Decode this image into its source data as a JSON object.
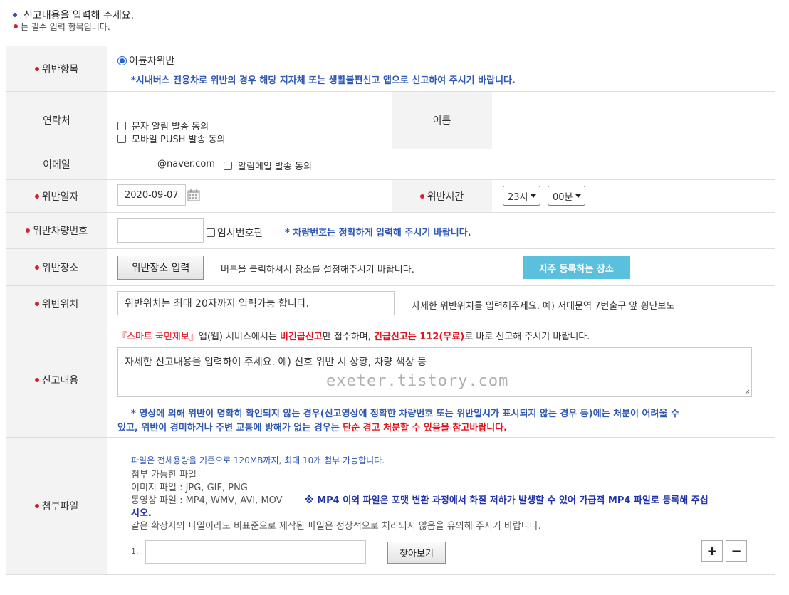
{
  "intro": {
    "line1": "신고내용을 입력해 주세요.",
    "line2": "는 필수 입력 항목입니다."
  },
  "violation_type": {
    "label": "위반항목",
    "radio_label": "이륜차위반",
    "notice": "*시내버스 전용차로 위반의 경우 해당 지자체 또는 생활불편신고 앱으로 신고하여 주시기 바랍니다."
  },
  "contact": {
    "label": "연락처",
    "sms_consent": "문자 알림 발송 동의",
    "push_consent": "모바일 PUSH 발송 동의",
    "name_label": "이름"
  },
  "email": {
    "label": "이메일",
    "domain": "@naver.com",
    "mail_consent": "알림메일 발송 동의"
  },
  "violation_date": {
    "label": "위반일자",
    "value": "2020-09-07",
    "time_label": "위반시간",
    "hour": "23시",
    "minute": "00분"
  },
  "plate": {
    "label": "위반차량번호",
    "temp_plate": "임시번호판",
    "notice": "* 차량번호는 정확하게 입력해 주시기 바랍니다."
  },
  "place": {
    "label": "위반장소",
    "input_button": "위반장소 입력",
    "help": "버튼을 클릭하셔서 장소를 설정해주시기 바랍니다.",
    "favorites_button": "자주 등록하는 장소"
  },
  "location": {
    "label": "위반위치",
    "placeholder": "위반위치는 최대 20자까지 입력가능 합니다.",
    "help": "자세한 위반위치를 입력해주세요. 예) 서대문역 7번출구 앞 횡단보도"
  },
  "content": {
    "label": "신고내용",
    "notice_part1": "『스마트 국민제보』",
    "notice_part2": "앱(웹) 서비스에서는 ",
    "notice_part3": "비긴급신고",
    "notice_part4": "만 접수하며, ",
    "notice_part5": "긴급신고는 112(무료)",
    "notice_part6": "로 바로 신고해 주시기 바랍니다.",
    "textarea_placeholder": "자세한 신고내용을 입력하여 주세요. 예) 신호 위반 시 상황, 차량 색상 등",
    "watermark": "exeter.tistory.com",
    "warning_line1": "* 영상에 의해 위반이 명확히 확인되지 않는 경우(신고영상에 정확한 차량번호 또는 위반일시가 표시되지 않는 경우 등)에는 처분이 어려울 수",
    "warning_line2a": "있고, 위반이 경미하거나 주변 교통에 방해가 없는 경우는 ",
    "warning_line2b": "단순 경고 처분할 수 있음을 참고바랍니다."
  },
  "attachment": {
    "label": "첨부파일",
    "size_limit": "파일은 전체용량을 기준으로 120MB까지, 최대 10개 첨부 가능합니다.",
    "allowed_title": "첨부 가능한 파일",
    "image_types": "이미지 파일 : JPG, GIF, PNG",
    "video_types": "동영상 파일 : MP4, WMV, AVI, MOV",
    "mp4_notice_line1": "※ MP4 이외 파일은 포맷 변환 과정에서 화질 저하가 발생할 수 있어 가급적 MP4 파일로 등록해 주십",
    "mp4_notice_line2": "시오.",
    "nonstandard_notice": "같은 확장자의 파일이라도 비표준으로 제작된 파일은 정상적으로 처리되지 않음을 유의해 주시기 바랍니다.",
    "file_index": "1.",
    "browse_button": "찾아보기",
    "add_button": "+",
    "remove_button": "−"
  },
  "colors": {
    "required_dot": "#d8202a",
    "notice_blue": "#2f59b3",
    "accent_teal": "#5bc0de",
    "header_bg": "#f3f3f3"
  }
}
